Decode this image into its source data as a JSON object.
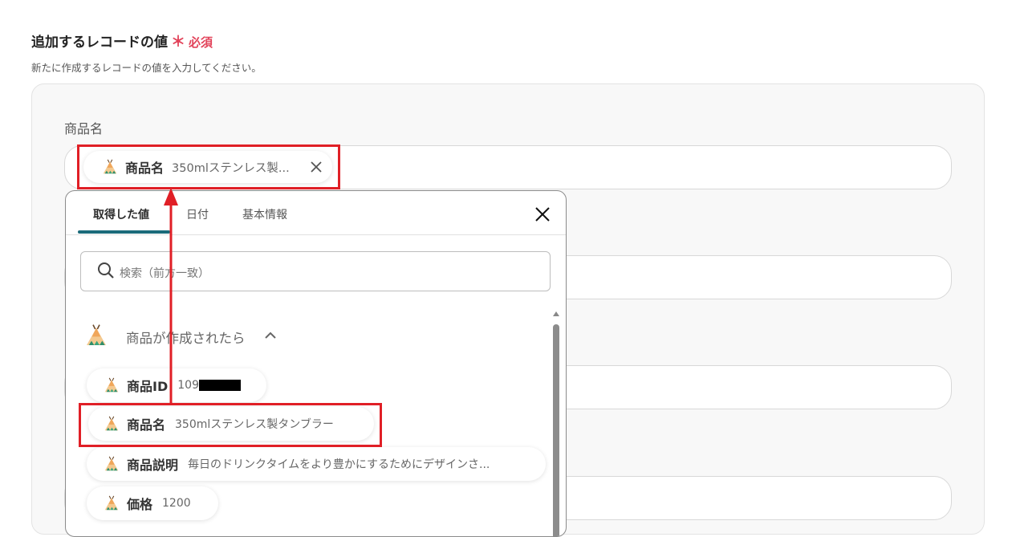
{
  "section": {
    "title": "追加するレコードの値",
    "required_mark": "＊",
    "required_label": "必須",
    "description": "新たに作成するレコードの値を入力してください。"
  },
  "field": {
    "label": "商品名",
    "selected_chip": {
      "name": "商品名",
      "value": "350mlステンレス製..."
    }
  },
  "popup": {
    "tabs": [
      {
        "label": "取得した値",
        "active": true
      },
      {
        "label": "日付",
        "active": false
      },
      {
        "label": "基本情報",
        "active": false
      }
    ],
    "search_placeholder": "検索（前方一致）",
    "group": {
      "title": "商品が作成されたら",
      "items": [
        {
          "name": "商品ID",
          "value": "109"
        },
        {
          "name": "商品名",
          "value": "350mlステンレス製タンブラー"
        },
        {
          "name": "商品説明",
          "value": "毎日のドリンクタイムをより豊かにするためにデザインさ..."
        },
        {
          "name": "価格",
          "value": "1200"
        }
      ]
    }
  },
  "colors": {
    "accent": "#1b6b7a",
    "required": "#e2435a",
    "highlight": "#e01f26"
  },
  "icons": [
    "tipi-icon",
    "clear-icon",
    "close-icon",
    "search-icon",
    "chevron-up-icon",
    "scroll-up-icon"
  ]
}
